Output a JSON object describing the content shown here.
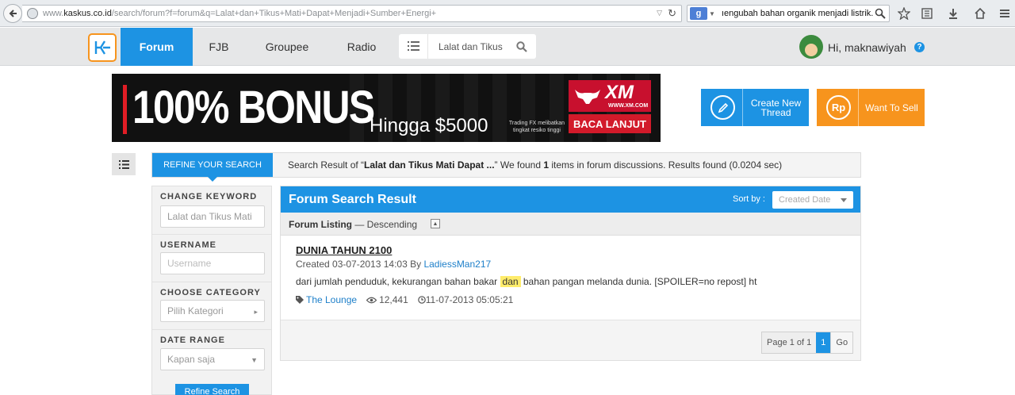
{
  "browser": {
    "url_prefix": "www.",
    "url_domain": "kaskus.co.id",
    "url_rest": "/search/forum?f=forum&q=Lalat+dan+Tikus+Mati+Dapat+Menjadi+Sumber+Energi+",
    "search_engine": "g",
    "search_text": "ıengubah bahan organik menjadi listrik."
  },
  "header": {
    "nav": [
      "Forum",
      "FJB",
      "Groupee",
      "Radio"
    ],
    "active_nav": "Forum",
    "search_value": "Lalat dan Tikus",
    "greeting": "Hi, maknawiyah",
    "help": "?"
  },
  "banner": {
    "headline": "100% BONUS",
    "amount": "Hingga $5000",
    "small": "Trading FX melibatkan tingkat resiko tinggi",
    "brand": "XM",
    "brand_url": "WWW.XM.COM",
    "cta": "BACA LANJUT"
  },
  "actions": {
    "create_label": "Create New Thread",
    "sell_icon": "Rp",
    "sell_label": "Want To Sell"
  },
  "refine": {
    "tab": "REFINE YOUR SEARCH",
    "summary_prefix": "Search Result of “",
    "summary_query": "Lalat dan Tikus Mati Dapat ...",
    "summary_mid": "” We found ",
    "summary_count": "1",
    "summary_suffix": " items in forum discussions. Results found (0.0204 sec)"
  },
  "sidebar": {
    "keyword_label": "CHANGE KEYWORD",
    "keyword_value": "Lalat dan Tikus Mati",
    "username_label": "USERNAME",
    "username_placeholder": "Username",
    "category_label": "CHOOSE CATEGORY",
    "category_value": "Pilih Kategori",
    "date_label": "DATE RANGE",
    "date_value": "Kapan saja",
    "refine_button": "Refine Search"
  },
  "results": {
    "title": "Forum Search Result",
    "sort_label": "Sort by :",
    "sort_value": "Created Date",
    "listing_label": "Forum Listing",
    "listing_order": " — Descending",
    "items": [
      {
        "title": "DUNIA TAHUN 2100",
        "created": "Created 03-07-2013 14:03 By ",
        "author": "LadiessMan217",
        "snippet_before": "dari jumlah penduduk, kekurangan bahan bakar ",
        "snippet_highlight": "dan",
        "snippet_after": " bahan pangan melanda dunia. [SPOILER=no repost] ht",
        "forum": "The Lounge",
        "views": "12,441",
        "last_post": "11-07-2013 05:05:21"
      }
    ],
    "pager": {
      "label": "Page 1 of 1",
      "current": "1",
      "go": "Go"
    }
  },
  "colors": {
    "brand_blue": "#1d93e3",
    "brand_orange": "#f7941d",
    "highlight": "#ffec6b"
  }
}
